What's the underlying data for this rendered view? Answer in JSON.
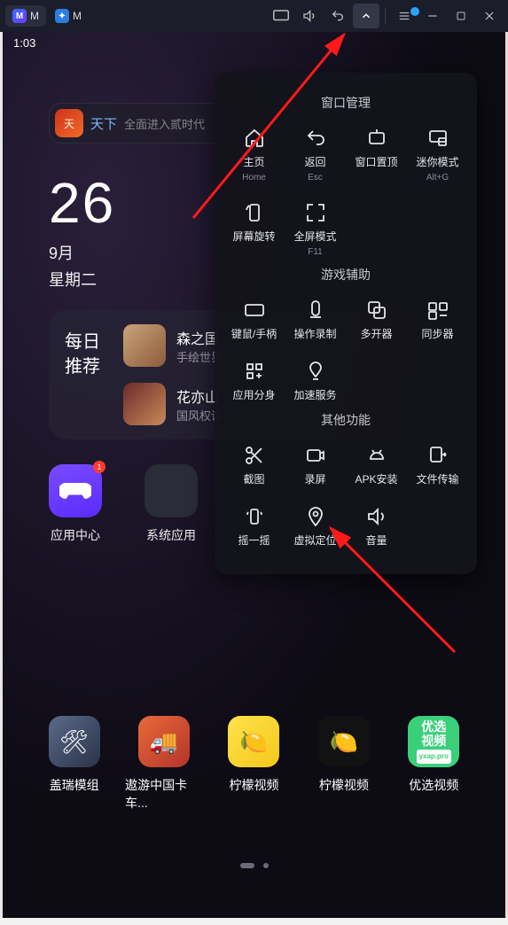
{
  "titlebar": {
    "tab1": "M",
    "tab2": "M"
  },
  "status": {
    "time": "1:03"
  },
  "promo": {
    "app": "天下",
    "text": "全面进入贰时代"
  },
  "date": {
    "day": "26",
    "month": "9月",
    "weekday": "星期二"
  },
  "reco": {
    "header_l1": "每日",
    "header_l2": "推荐",
    "items": [
      {
        "title": "森之国",
        "sub": "手绘世界"
      },
      {
        "title": "花亦山",
        "sub": "国风权谋"
      }
    ]
  },
  "home": {
    "app_center": "应用中心",
    "sys_apps": "系统应用",
    "badge": "1"
  },
  "dock": [
    {
      "label": "盖瑞模组"
    },
    {
      "label": "遨游中国卡车..."
    },
    {
      "label": "柠檬视频"
    },
    {
      "label": "柠檬视频"
    },
    {
      "label": "优选视频"
    }
  ],
  "dock_tile5_l1": "优选",
  "dock_tile5_l2": "视频",
  "dock_tile5_l3": "yxap.pro",
  "popup": {
    "sec1": "窗口管理",
    "sec2": "游戏辅助",
    "sec3": "其他功能",
    "items": {
      "home": {
        "label": "主页",
        "sub": "Home"
      },
      "back": {
        "label": "返回",
        "sub": "Esc"
      },
      "ontop": {
        "label": "窗口置顶",
        "sub": ""
      },
      "mini": {
        "label": "迷你模式",
        "sub": "Alt+G"
      },
      "rotate": {
        "label": "屏幕旋转",
        "sub": ""
      },
      "full": {
        "label": "全屏模式",
        "sub": "F11"
      },
      "keypad": {
        "label": "键鼠/手柄",
        "sub": ""
      },
      "record": {
        "label": "操作录制",
        "sub": ""
      },
      "multi": {
        "label": "多开器",
        "sub": ""
      },
      "sync": {
        "label": "同步器",
        "sub": ""
      },
      "clone": {
        "label": "应用分身",
        "sub": ""
      },
      "boost": {
        "label": "加速服务",
        "sub": ""
      },
      "shot": {
        "label": "截图",
        "sub": ""
      },
      "rec": {
        "label": "录屏",
        "sub": ""
      },
      "apk": {
        "label": "APK安装",
        "sub": ""
      },
      "file": {
        "label": "文件传输",
        "sub": ""
      },
      "shake": {
        "label": "摇一摇",
        "sub": ""
      },
      "gps": {
        "label": "虚拟定位",
        "sub": ""
      },
      "volume": {
        "label": "音量",
        "sub": ""
      }
    }
  }
}
